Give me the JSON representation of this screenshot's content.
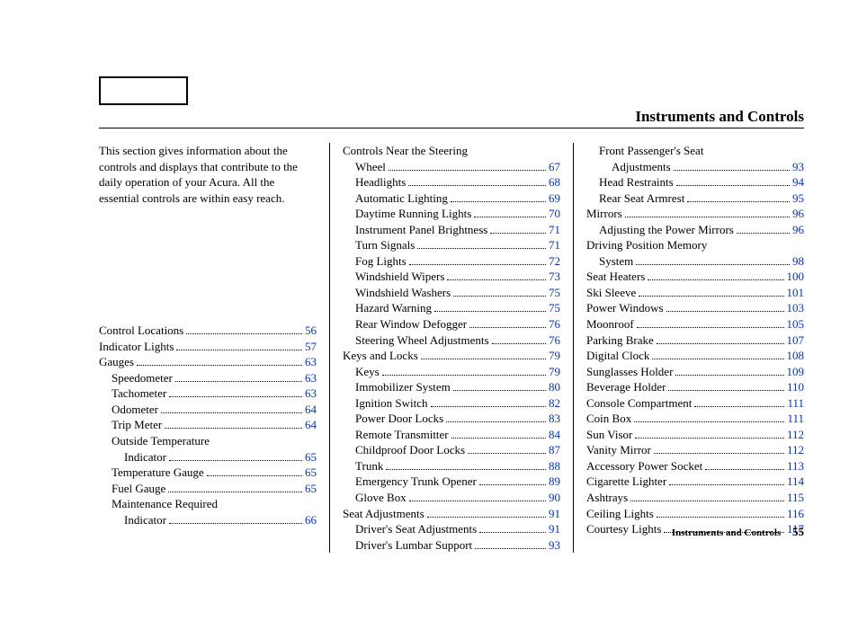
{
  "header_title": "Instruments and Controls",
  "intro": "This section gives information about the controls and displays that contribute to the daily operation of your Acura. All the essential controls are within easy reach.",
  "col1": [
    {
      "label": "Control Locations",
      "page": "56",
      "indent": 0
    },
    {
      "label": "Indicator Lights",
      "page": "57",
      "indent": 0
    },
    {
      "label": "Gauges",
      "page": "63",
      "indent": 0
    },
    {
      "label": "Speedometer",
      "page": "63",
      "indent": 1
    },
    {
      "label": "Tachometer",
      "page": "63",
      "indent": 1
    },
    {
      "label": "Odometer",
      "page": "64",
      "indent": 1
    },
    {
      "label": "Trip Meter",
      "page": "64",
      "indent": 1
    },
    {
      "label": "Outside Temperature",
      "page": null,
      "indent": 1
    },
    {
      "label": "Indicator",
      "page": "65",
      "indent": 2
    },
    {
      "label": "Temperature Gauge",
      "page": "65",
      "indent": 1
    },
    {
      "label": "Fuel Gauge",
      "page": "65",
      "indent": 1
    },
    {
      "label": "Maintenance Required",
      "page": null,
      "indent": 1
    },
    {
      "label": "Indicator",
      "page": "66",
      "indent": 2
    }
  ],
  "col2": [
    {
      "label": "Controls Near the Steering",
      "page": null,
      "indent": 0
    },
    {
      "label": "Wheel",
      "page": "67",
      "indent": 1
    },
    {
      "label": "Headlights",
      "page": "68",
      "indent": 1
    },
    {
      "label": "Automatic Lighting",
      "page": "69",
      "indent": 1
    },
    {
      "label": "Daytime Running Lights",
      "page": "70",
      "indent": 1
    },
    {
      "label": "Instrument Panel Brightness",
      "page": "71",
      "indent": 1
    },
    {
      "label": "Turn Signals",
      "page": "71",
      "indent": 1
    },
    {
      "label": "Fog Lights",
      "page": "72",
      "indent": 1
    },
    {
      "label": "Windshield Wipers",
      "page": "73",
      "indent": 1
    },
    {
      "label": "Windshield Washers",
      "page": "75",
      "indent": 1
    },
    {
      "label": "Hazard Warning",
      "page": "75",
      "indent": 1
    },
    {
      "label": "Rear Window Defogger",
      "page": "76",
      "indent": 1
    },
    {
      "label": "Steering Wheel Adjustments",
      "page": "76",
      "indent": 1
    },
    {
      "label": "Keys and Locks",
      "page": "79",
      "indent": 0
    },
    {
      "label": "Keys",
      "page": "79",
      "indent": 1
    },
    {
      "label": "Immobilizer System",
      "page": "80",
      "indent": 1
    },
    {
      "label": "Ignition Switch",
      "page": "82",
      "indent": 1
    },
    {
      "label": "Power Door Locks",
      "page": "83",
      "indent": 1
    },
    {
      "label": "Remote Transmitter",
      "page": "84",
      "indent": 1
    },
    {
      "label": "Childproof Door Locks",
      "page": "87",
      "indent": 1
    },
    {
      "label": "Trunk",
      "page": "88",
      "indent": 1
    },
    {
      "label": "Emergency Trunk Opener",
      "page": "89",
      "indent": 1
    },
    {
      "label": "Glove Box",
      "page": "90",
      "indent": 1
    },
    {
      "label": "Seat Adjustments",
      "page": "91",
      "indent": 0
    },
    {
      "label": "Driver's Seat Adjustments",
      "page": "91",
      "indent": 1
    },
    {
      "label": "Driver's Lumbar Support",
      "page": "93",
      "indent": 1
    }
  ],
  "col3": [
    {
      "label": "Front Passenger's Seat",
      "page": null,
      "indent": 1
    },
    {
      "label": "Adjustments",
      "page": "93",
      "indent": 2
    },
    {
      "label": "Head Restraints",
      "page": "94",
      "indent": 1
    },
    {
      "label": "Rear Seat Armrest",
      "page": "95",
      "indent": 1
    },
    {
      "label": "Mirrors",
      "page": "96",
      "indent": 0
    },
    {
      "label": "Adjusting the Power Mirrors",
      "page": "96",
      "indent": 1
    },
    {
      "label": "Driving Position Memory",
      "page": null,
      "indent": 0
    },
    {
      "label": "System",
      "page": "98",
      "indent": 1
    },
    {
      "label": "Seat Heaters",
      "page": "100",
      "indent": 0
    },
    {
      "label": "Ski Sleeve",
      "page": "101",
      "indent": 0
    },
    {
      "label": "Power Windows",
      "page": "103",
      "indent": 0
    },
    {
      "label": "Moonroof",
      "page": "105",
      "indent": 0
    },
    {
      "label": "Parking Brake",
      "page": "107",
      "indent": 0
    },
    {
      "label": "Digital Clock",
      "page": "108",
      "indent": 0
    },
    {
      "label": "Sunglasses Holder",
      "page": "109",
      "indent": 0
    },
    {
      "label": "Beverage Holder",
      "page": "110",
      "indent": 0
    },
    {
      "label": "Console Compartment",
      "page": "111",
      "indent": 0
    },
    {
      "label": "Coin Box",
      "page": "111",
      "indent": 0
    },
    {
      "label": "Sun Visor",
      "page": "112",
      "indent": 0
    },
    {
      "label": "Vanity Mirror",
      "page": "112",
      "indent": 0
    },
    {
      "label": "Accessory Power Socket",
      "page": "113",
      "indent": 0
    },
    {
      "label": "Cigarette Lighter",
      "page": "114",
      "indent": 0
    },
    {
      "label": "Ashtrays",
      "page": "115",
      "indent": 0
    },
    {
      "label": "Ceiling Lights",
      "page": "116",
      "indent": 0
    },
    {
      "label": "Courtesy Lights",
      "page": "117",
      "indent": 0
    }
  ],
  "footer_title": "Instruments and Controls",
  "footer_page": "55"
}
